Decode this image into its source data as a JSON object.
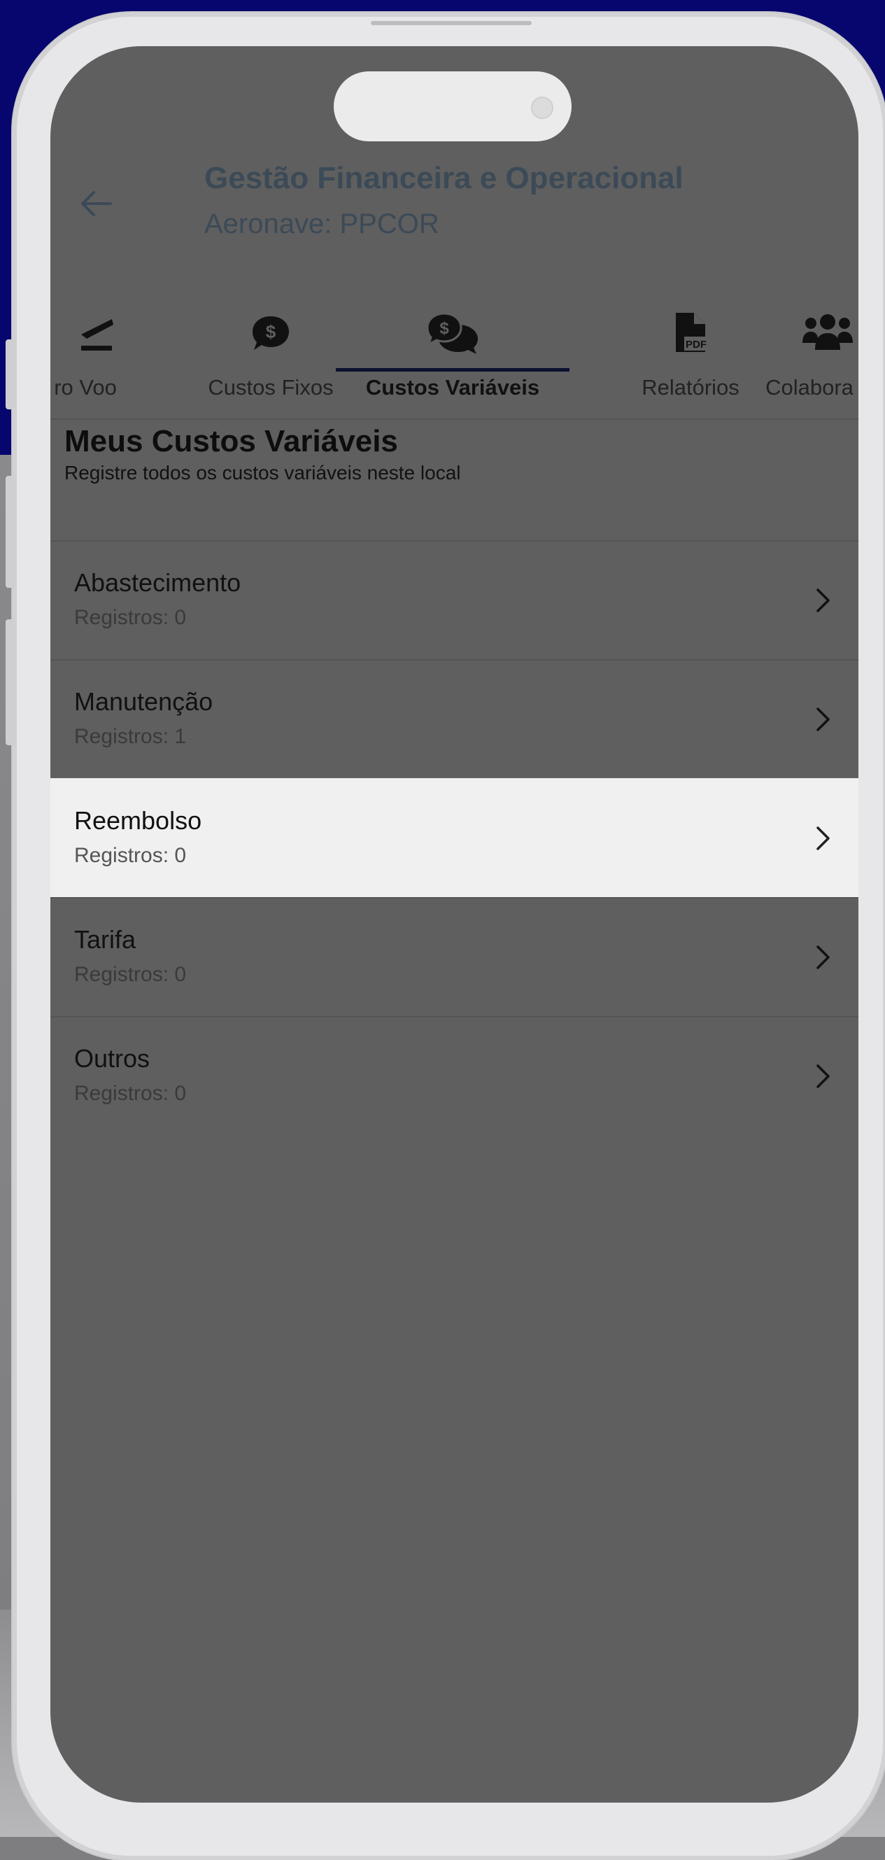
{
  "header": {
    "title": "Gestão Financeira e Operacional",
    "subtitle": "Aeronave: PPCOR"
  },
  "tabs": [
    {
      "label": "ro Voo",
      "icon": "plane-takeoff-icon",
      "active": false
    },
    {
      "label": "Custos Fixos",
      "icon": "dollar-bubble-icon",
      "active": false
    },
    {
      "label": "Custos Variáveis",
      "icon": "dollar-chat-bubbles-icon",
      "active": true
    },
    {
      "label": "Relatórios",
      "icon": "pdf-file-icon",
      "active": false
    },
    {
      "label": "Colabora",
      "icon": "users-group-icon",
      "active": false
    }
  ],
  "section": {
    "title": "Meus Custos Variáveis",
    "subtitle": "Registre todos os custos variáveis neste local"
  },
  "items": [
    {
      "name": "Abastecimento",
      "count": "Registros: 0",
      "selected": false
    },
    {
      "name": "Manutenção",
      "count": "Registros: 1",
      "selected": false
    },
    {
      "name": "Reembolso",
      "count": "Registros: 0",
      "selected": true
    },
    {
      "name": "Tarifa",
      "count": "Registros: 0",
      "selected": false
    },
    {
      "name": "Outros",
      "count": "Registros: 0",
      "selected": false
    }
  ],
  "colors": {
    "background_top": "#06066e",
    "screen_overlay": "#5f5f5f",
    "title_color": "#3c4a57",
    "tab_indicator": "#0a1230",
    "selected_row": "#f0f0f0"
  }
}
